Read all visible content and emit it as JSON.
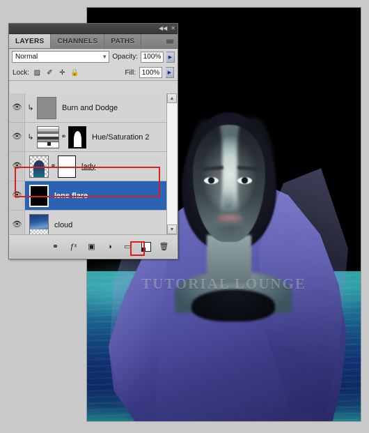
{
  "photo": {
    "watermark": "TUTORIAL LOUNGE",
    "alt": "woman in purple hood standing in teal water at night"
  },
  "panel": {
    "titlebar": {
      "collapse_icon": "◀◀",
      "close_icon": "✕"
    },
    "tabs": [
      {
        "label": "LAYERS",
        "active": true
      },
      {
        "label": "CHANNELS",
        "active": false
      },
      {
        "label": "PATHS",
        "active": false
      }
    ],
    "menu_icon": "panel-menu-icon",
    "blend": {
      "mode": "Normal",
      "chevron": "▼",
      "opacity_label": "Opacity:",
      "opacity_value": "100%",
      "spinner": "▶"
    },
    "lock": {
      "label": "Lock:",
      "icons": [
        {
          "name": "lock-transparent-pixels-icon",
          "glyph": "▨"
        },
        {
          "name": "lock-image-pixels-icon",
          "glyph": "✐"
        },
        {
          "name": "lock-position-icon",
          "glyph": "✛"
        },
        {
          "name": "lock-all-icon",
          "glyph": "🔒"
        }
      ],
      "fill_label": "Fill:",
      "fill_value": "100%",
      "spinner": "▶"
    },
    "layers": [
      {
        "name": "Burn and Dodge",
        "visible": true,
        "eye_icon": "👁",
        "clipped": true,
        "clip_icon": "↳",
        "selected": false,
        "thumb_kind": "gray",
        "has_mask": false,
        "linked": false,
        "underline": false
      },
      {
        "name": "Hue/Saturation 2",
        "visible": true,
        "eye_icon": "👁",
        "clipped": true,
        "clip_icon": "↳",
        "selected": false,
        "thumb_kind": "huesat",
        "has_mask": true,
        "mask_kind": "figure",
        "linked": true,
        "link_icon": "⚭",
        "underline": false
      },
      {
        "name": "lady",
        "visible": true,
        "eye_icon": "👁",
        "clipped": false,
        "selected": false,
        "thumb_kind": "lady",
        "has_mask": true,
        "mask_kind": "white",
        "linked": true,
        "link_icon": "⚭",
        "underline": true
      },
      {
        "name": "lens flare",
        "visible": true,
        "eye_icon": "👁",
        "clipped": false,
        "selected": true,
        "thumb_kind": "black",
        "has_mask": false,
        "linked": false,
        "underline": false
      },
      {
        "name": "cloud",
        "visible": true,
        "eye_icon": "👁",
        "clipped": false,
        "selected": false,
        "thumb_kind": "cloud",
        "has_mask": false,
        "linked": false,
        "underline": false
      }
    ],
    "scrollbar": {
      "up_arrow": "▲",
      "down_arrow": "▼"
    },
    "footer_icons": [
      {
        "name": "link-layers-button",
        "glyph": "⚭"
      },
      {
        "name": "layer-style-fx-button",
        "glyph": "ƒˣ"
      },
      {
        "name": "add-layer-mask-button",
        "glyph": "▣"
      },
      {
        "name": "new-adjustment-layer-button",
        "glyph": "◑"
      },
      {
        "name": "new-group-button",
        "glyph": "▭"
      },
      {
        "name": "new-layer-button",
        "glyph": ""
      },
      {
        "name": "delete-layer-button",
        "glyph": "🗑"
      }
    ]
  },
  "annotations": {
    "selected_layer_highlight": "lens flare",
    "new_layer_highlight": "new-layer-button",
    "color": "#d61f1f"
  }
}
